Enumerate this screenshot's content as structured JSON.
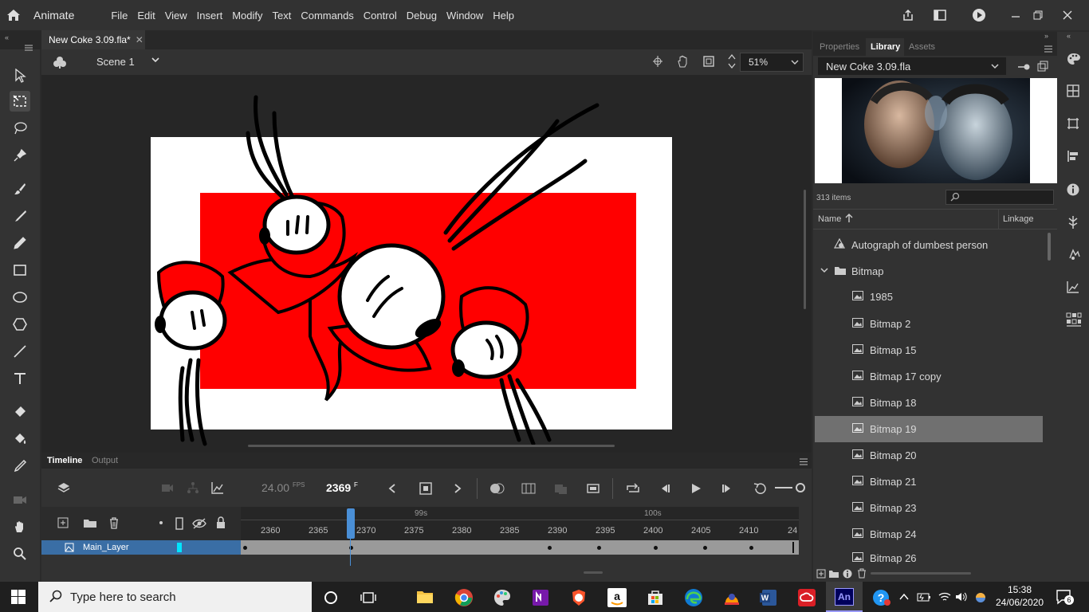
{
  "app": {
    "name": "Animate"
  },
  "menu": [
    "File",
    "Edit",
    "View",
    "Insert",
    "Modify",
    "Text",
    "Commands",
    "Control",
    "Debug",
    "Window",
    "Help"
  ],
  "document": {
    "tab_title": "New Coke 3.09.fla*"
  },
  "scene": {
    "label": "Scene 1",
    "zoom": "51%"
  },
  "timeline": {
    "tabs": [
      "Timeline",
      "Output"
    ],
    "fps_value": "24.00",
    "fps_unit": "FPS",
    "current_frame": "2369",
    "frame_unit": "F",
    "time_markers": [
      "99s",
      "100s"
    ],
    "ruler": [
      "2360",
      "2365",
      "2370",
      "2375",
      "2380",
      "2385",
      "2390",
      "2395",
      "2400",
      "2405",
      "2410",
      "24"
    ],
    "layer_name": "Main_Layer",
    "layer_color": "#00e5ff"
  },
  "right_panel": {
    "tabs": [
      "Properties",
      "Library",
      "Assets"
    ],
    "active_tab": "Library",
    "library_file": "New Coke 3.09.fla",
    "item_count": "313 items",
    "col_name": "Name",
    "col_linkage": "Linkage",
    "items": [
      {
        "label": "Autograph of dumbest person",
        "icon": "graphic-symbol-icon"
      },
      {
        "label": "Bitmap",
        "icon": "folder-icon"
      },
      {
        "label": "1985",
        "icon": "bitmap-icon"
      },
      {
        "label": "Bitmap 2",
        "icon": "bitmap-icon"
      },
      {
        "label": "Bitmap 15",
        "icon": "bitmap-icon"
      },
      {
        "label": "Bitmap 17 copy",
        "icon": "bitmap-icon"
      },
      {
        "label": "Bitmap 18",
        "icon": "bitmap-icon"
      },
      {
        "label": "Bitmap 19",
        "icon": "bitmap-icon"
      },
      {
        "label": "Bitmap 20",
        "icon": "bitmap-icon"
      },
      {
        "label": "Bitmap 21",
        "icon": "bitmap-icon"
      },
      {
        "label": "Bitmap 23",
        "icon": "bitmap-icon"
      },
      {
        "label": "Bitmap 24",
        "icon": "bitmap-icon"
      },
      {
        "label": "Bitmap 26",
        "icon": "bitmap-icon"
      }
    ],
    "selected_item": "Bitmap 19"
  },
  "taskbar": {
    "search_placeholder": "Type here to search",
    "time": "15:38",
    "date": "24/06/2020",
    "notifications": "6"
  },
  "colors": {
    "accent": "#2680eb",
    "stage_red": "#ff0000",
    "layer_highlight": "#3a6ea5",
    "playhead": "#4a8fd6"
  }
}
